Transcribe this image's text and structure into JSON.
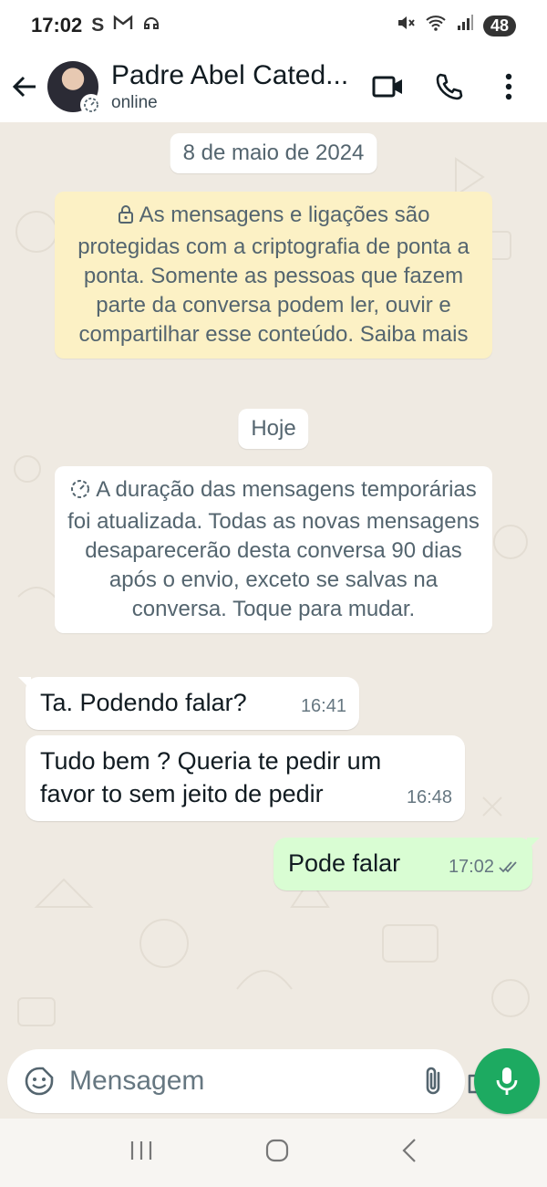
{
  "status_bar": {
    "time": "17:02",
    "notif_icons": [
      "S",
      "M",
      "headset"
    ],
    "battery": "48"
  },
  "header": {
    "contact_name": "Padre Abel Cated...",
    "status": "online"
  },
  "chat": {
    "date_chip": "8 de maio de 2024",
    "encryption_notice": "As mensagens e ligações são protegidas com a criptografia de ponta a ponta. Somente as pessoas que fazem parte da conversa podem ler, ouvir e compartilhar esse conteúdo. Saiba mais",
    "today_chip": "Hoje",
    "timer_notice": "A duração das mensagens temporárias foi atualizada. Todas as novas mensagens desaparecerão desta conversa 90 dias após o envio, exceto se salvas na conversa. Toque para mudar.",
    "messages": [
      {
        "direction": "in",
        "text": "Ta. Podendo falar?",
        "time": "16:41"
      },
      {
        "direction": "in",
        "text": "Tudo bem ? Queria te pedir um favor to sem jeito de pedir",
        "time": "16:48"
      },
      {
        "direction": "out",
        "text": "Pode falar",
        "time": "17:02"
      }
    ]
  },
  "composer": {
    "placeholder": "Mensagem"
  },
  "colors": {
    "accent": "#1daa61",
    "outgoing_bubble": "#d9fdd3",
    "encryption_note": "#fcf1c5",
    "chat_bg": "#efeae2"
  }
}
